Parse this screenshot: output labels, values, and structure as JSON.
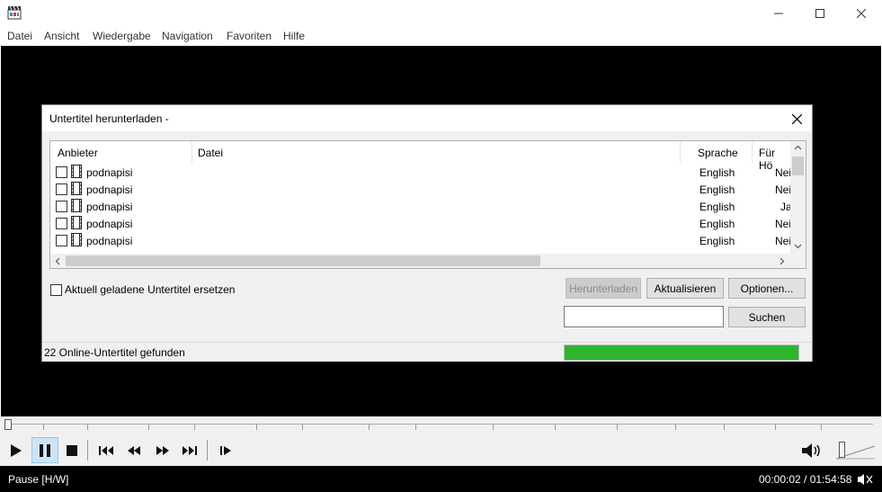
{
  "window": {
    "app_icon": "film-clapper-icon",
    "controls": [
      "minimize-icon",
      "maximize-icon",
      "close-icon"
    ]
  },
  "menu": [
    "Datei",
    "Ansicht",
    "Wiedergabe",
    "Navigation",
    "Favoriten",
    "Hilfe"
  ],
  "dialog": {
    "title": "Untertitel herunterladen -",
    "columns": [
      "Anbieter",
      "Datei",
      "Sprache",
      "Für Hö"
    ],
    "rows": [
      {
        "provider": "podnapisi",
        "file": "",
        "language": "English",
        "hearing": "Nei"
      },
      {
        "provider": "podnapisi",
        "file": "",
        "language": "English",
        "hearing": "Nei"
      },
      {
        "provider": "podnapisi",
        "file": "",
        "language": "English",
        "hearing": "Ja"
      },
      {
        "provider": "podnapisi",
        "file": "",
        "language": "English",
        "hearing": "Nei"
      },
      {
        "provider": "podnapisi",
        "file": "",
        "language": "English",
        "hearing": "Nei"
      }
    ],
    "replace_checkbox_label": "Aktuell geladene Untertitel ersetzen",
    "buttons": {
      "download": "Herunterladen",
      "refresh": "Aktualisieren",
      "options": "Optionen...",
      "search": "Suchen"
    },
    "search_value": "",
    "status_text": "22 Online-Untertitel gefunden",
    "progress": 1.0,
    "progress_color": "#2db52d"
  },
  "player": {
    "status": "Pause [H/W]",
    "time": "00:00:02 / 01:54:58",
    "volume_icon": "speaker-icon"
  }
}
